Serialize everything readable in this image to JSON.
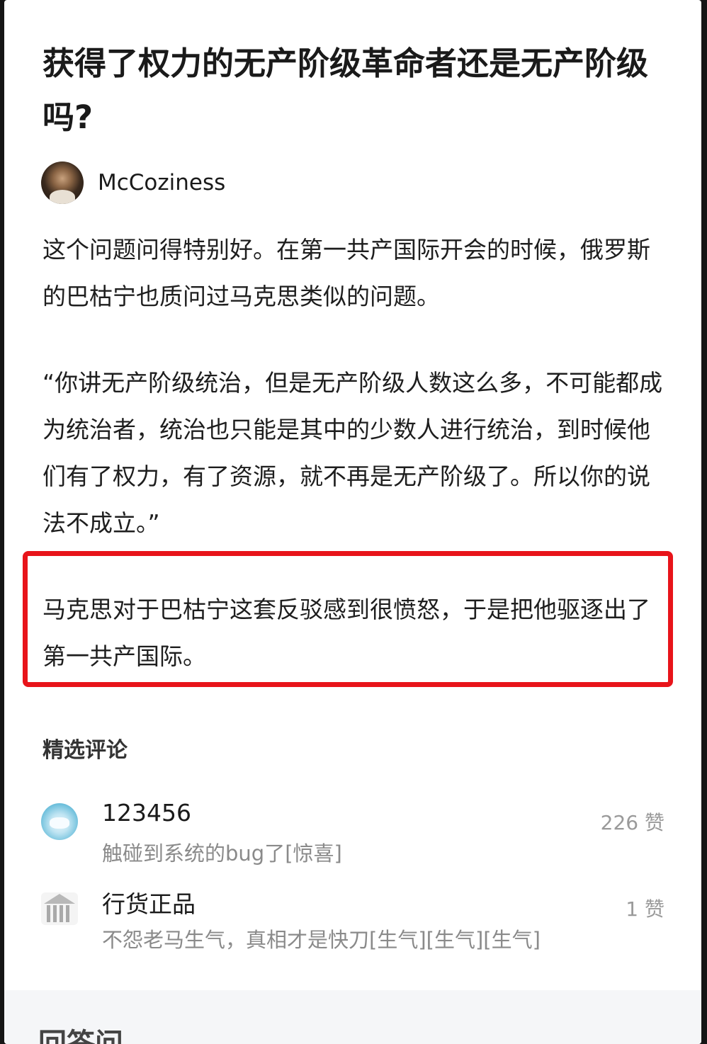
{
  "article": {
    "title": "获得了权力的无产阶级革命者还是无产阶级吗?",
    "author": "McCoziness",
    "paragraphs": [
      "这个问题问得特别好。在第一共产国际开会的时候，俄罗斯的巴枯宁也质问过马克思类似的问题。",
      "“你讲无产阶级统治，但是无产阶级人数这么多，不可能都成为统治者，统治也只能是其中的少数人进行统治，到时候他们有了权力，有了资源，就不再是无产阶级了。所以你的说法不成立。”",
      "马克思对于巴枯宁这套反驳感到很愤怒，于是把他驱逐出了第一共产国际。"
    ],
    "highlight_color": "#e8141a"
  },
  "comments": {
    "section_title": "精选评论",
    "items": [
      {
        "name": "123456",
        "text": "触碰到系统的bug了[惊喜]",
        "likes": "226 赞"
      },
      {
        "name": "行货正品",
        "text": "不怨老马生气，真相才是快刀[生气][生气][生气]",
        "likes": "1 赞"
      }
    ]
  },
  "footer": {
    "label": "回答问"
  }
}
